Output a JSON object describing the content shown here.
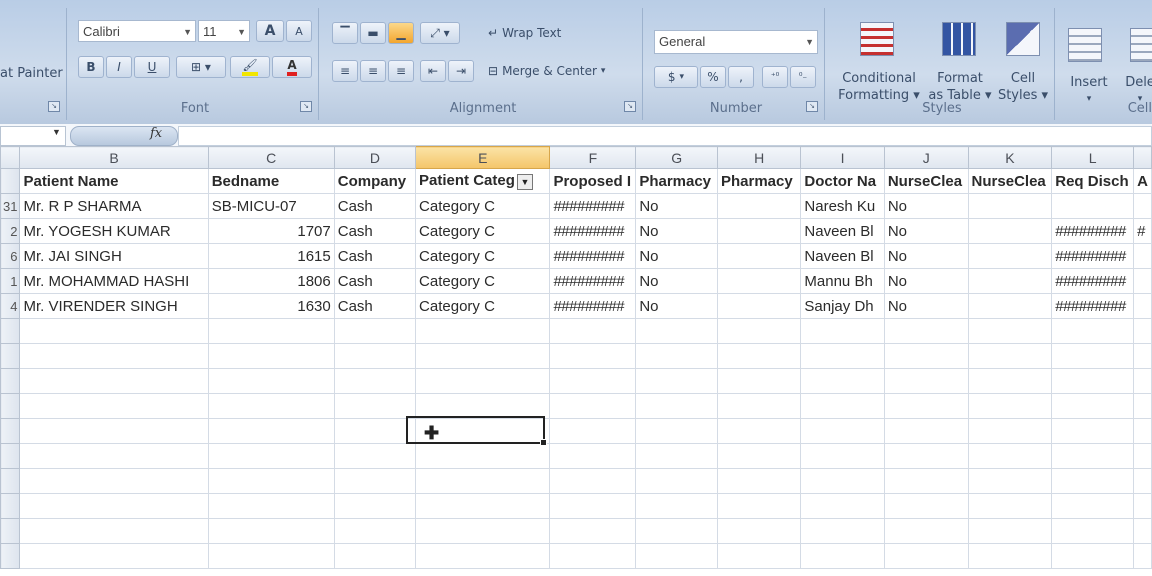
{
  "ribbon": {
    "clipboard": {
      "format_painter": "at Painter"
    },
    "font": {
      "label": "Font",
      "font_name": "Calibri",
      "font_size": "11",
      "grow_font": "A",
      "shrink_font": "A",
      "bold": "B",
      "italic": "I",
      "underline": "U",
      "font_color": "A"
    },
    "alignment": {
      "label": "Alignment",
      "wrap_text": "Wrap Text",
      "merge_center": "Merge & Center"
    },
    "number": {
      "label": "Number",
      "format": "General",
      "currency": "$",
      "percent": "%",
      "comma": ","
    },
    "styles": {
      "label": "Styles",
      "conditional_formatting": [
        "Conditional",
        "Formatting"
      ],
      "format_as_table": [
        "Format",
        "as Table"
      ],
      "cell_styles": [
        "Cell",
        "Styles"
      ]
    },
    "cells": {
      "label": "Cell",
      "insert": "Insert",
      "delete": "Dele"
    }
  },
  "formula_bar": {
    "fx": "fx",
    "name_box": "",
    "content": ""
  },
  "sheet": {
    "columns": [
      "B",
      "C",
      "D",
      "E",
      "F",
      "G",
      "H",
      "I",
      "J",
      "K",
      "L"
    ],
    "selected_column": "E",
    "headers": [
      "Patient Name",
      "Bedname",
      "Company",
      "Patient Categ",
      "Proposed I",
      "Pharmacy",
      "Pharmacy",
      "Doctor Na",
      "NurseClea",
      "NurseClea",
      "Req Disch",
      "A"
    ],
    "rows": [
      {
        "rownum": "31",
        "name": "Mr. R P  SHARMA",
        "bed": "SB-MICU-07",
        "company": "Cash",
        "category": "Category C",
        "proposed": "#########",
        "pharmacy": "No",
        "pharmacy2": "",
        "doctor": "Naresh Ku",
        "nurse1": "No",
        "nurse2": "",
        "req": "",
        "a": ""
      },
      {
        "rownum": "2",
        "name": "Mr. YOGESH  KUMAR",
        "bed": "1707",
        "company": "Cash",
        "category": "Category C",
        "proposed": "#########",
        "pharmacy": "No",
        "pharmacy2": "",
        "doctor": "Naveen Bl",
        "nurse1": "No",
        "nurse2": "",
        "req": "#########",
        "a": "#"
      },
      {
        "rownum": "6",
        "name": "Mr. JAI  SINGH",
        "bed": "1615",
        "company": "Cash",
        "category": "Category C",
        "proposed": "#########",
        "pharmacy": "No",
        "pharmacy2": "",
        "doctor": "Naveen Bl",
        "nurse1": "No",
        "nurse2": "",
        "req": "#########",
        "a": ""
      },
      {
        "rownum": "1",
        "name": "Mr. MOHAMMAD HASHI",
        "bed": "1806",
        "company": "Cash",
        "category": "Category C",
        "proposed": "#########",
        "pharmacy": "No",
        "pharmacy2": "",
        "doctor": "Mannu Bh",
        "nurse1": "No",
        "nurse2": "",
        "req": "#########",
        "a": ""
      },
      {
        "rownum": "4",
        "name": "Mr. VIRENDER  SINGH",
        "bed": "1630",
        "company": "Cash",
        "category": "Category C",
        "proposed": "#########",
        "pharmacy": "No",
        "pharmacy2": "",
        "doctor": "Sanjay Dh",
        "nurse1": "No",
        "nurse2": "",
        "req": "#########",
        "a": ""
      }
    ]
  },
  "colors": {
    "ribbon_bg": "#cfdcec",
    "selected_header": "#f4c56a",
    "grid_line": "#d4dbe5"
  }
}
